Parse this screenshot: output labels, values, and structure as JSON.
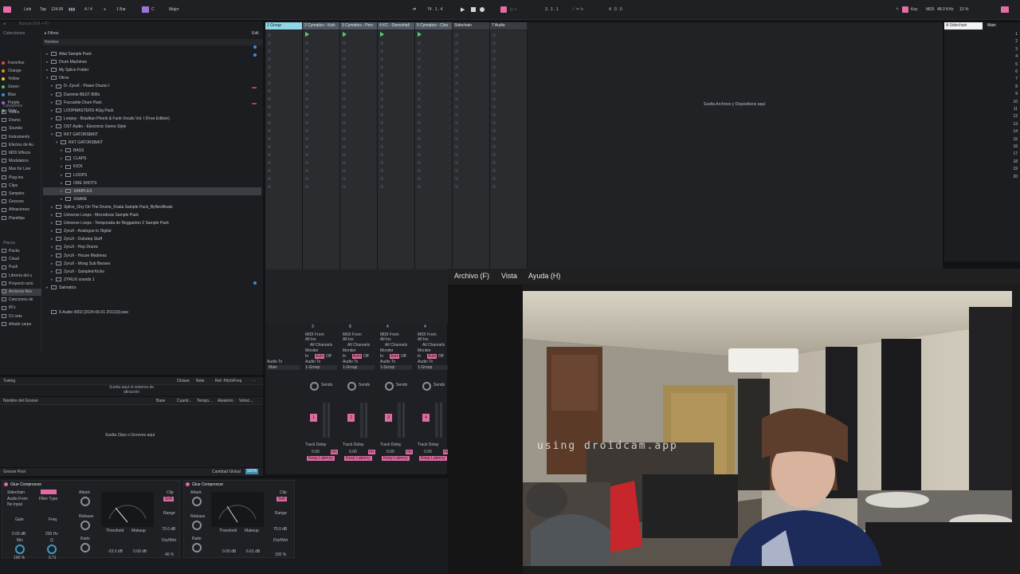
{
  "topbar": {
    "link": "Link",
    "tap": "Tap",
    "tempo": "124.00",
    "signature": "4 / 4",
    "quantize": "1 Bar",
    "key": "C",
    "scale": "Major",
    "position": "74 . 1 . 4",
    "loop_start": "3 . 1 . 1",
    "loop_length": "4 . 0 . 0",
    "key_label": "Key",
    "midi_label": "MIDI",
    "sample_rate": "48.0 KHz",
    "cpu": "13 %"
  },
  "browser": {
    "search_placeholder": "Buscar (Ctrl + F)",
    "filters_label": "Filtros",
    "edit_label": "Edit",
    "name_header": "Nombre",
    "collections_label": "Colecciones",
    "collections": [
      {
        "label": "Favoritos",
        "color": "#e04a4a"
      },
      {
        "label": "Orange",
        "color": "#e8872f"
      },
      {
        "label": "Yellow",
        "color": "#e1cd33"
      },
      {
        "label": "Green",
        "color": "#55c15a"
      },
      {
        "label": "Blue",
        "color": "#3e8de0"
      },
      {
        "label": "Purple",
        "color": "#a25ad6"
      },
      {
        "label": "Gray",
        "color": "#8f9297"
      }
    ],
    "categories_label": "Categories",
    "categories": [
      "Todos",
      "Drums",
      "Sounds",
      "Instruments",
      "Efectos de Au",
      "MIDI Effects",
      "Modulators",
      "Max for Live",
      "Plug-ins",
      "Clips",
      "Samples",
      "Grooves",
      "Afinaciones",
      "Plantillas"
    ],
    "places_label": "Places",
    "places": [
      "Packs",
      "Cloud",
      "Push",
      "Librería del u",
      "Proyecto actu",
      "Archivos Rec",
      "Canciones de",
      "IR's",
      "DJ sets",
      "Añadir carpe"
    ],
    "files": [
      {
        "label": "Atlat Sample Pack",
        "indent": 0,
        "arrow": "▸"
      },
      {
        "label": "Drum Machines",
        "indent": 0,
        "arrow": "▸"
      },
      {
        "label": "My Splice Folder",
        "indent": 0,
        "arrow": "▸"
      },
      {
        "label": "Otros",
        "indent": 0,
        "arrow": "▾"
      },
      {
        "label": "D- ZyruX - Power Drums I",
        "indent": 1,
        "arrow": "▸"
      },
      {
        "label": "Dummie BEST 808s",
        "indent": 1,
        "arrow": "▸"
      },
      {
        "label": "Foccanite  Drum  Pack",
        "indent": 1,
        "arrow": "▸"
      },
      {
        "label": "LOOPMASTERS 4Gig Pack",
        "indent": 1,
        "arrow": "▸"
      },
      {
        "label": "Loopsy - Brazilian Phonk & Funk Vocals Vol. I (Free Edition)",
        "indent": 1,
        "arrow": "▸"
      },
      {
        "label": "OST Audio - Electronic Genre Style",
        "indent": 1,
        "arrow": "▸"
      },
      {
        "label": "RKT GATORSBAIT",
        "indent": 1,
        "arrow": "▾"
      },
      {
        "label": "RKT GATORSBAIT",
        "indent": 2,
        "arrow": "▾"
      },
      {
        "label": "BASS",
        "indent": 3,
        "arrow": "▸"
      },
      {
        "label": "CLAPS",
        "indent": 3,
        "arrow": "▸"
      },
      {
        "label": "KICK",
        "indent": 3,
        "arrow": "▸"
      },
      {
        "label": "LOOPS",
        "indent": 3,
        "arrow": "▸"
      },
      {
        "label": "ONE SHOTS",
        "indent": 3,
        "arrow": "▸"
      },
      {
        "label": "SAMPLES",
        "indent": 3,
        "arrow": "▸",
        "selected": true
      },
      {
        "label": "SNARE",
        "indent": 3,
        "arrow": "▸"
      },
      {
        "label": "Splice_Ony On The Drums_Koala Sample Pack_ByNeoBeats",
        "indent": 1,
        "arrow": "▸"
      },
      {
        "label": "Universe Loops - Microdosis Sample Pack",
        "indent": 1,
        "arrow": "▸"
      },
      {
        "label": "Universe Loops - Temporada de Reggaeton 2 Sample Pack",
        "indent": 1,
        "arrow": "▸"
      },
      {
        "label": "ZyruX - Analogue to Digital",
        "indent": 1,
        "arrow": "▸"
      },
      {
        "label": "ZyruX - Dubstep Stuff",
        "indent": 1,
        "arrow": "▸"
      },
      {
        "label": "ZyruX - Hop Drums",
        "indent": 1,
        "arrow": "▸"
      },
      {
        "label": "ZyruX - House Madness",
        "indent": 1,
        "arrow": "▸"
      },
      {
        "label": "ZyruX - Moog Sub Basses",
        "indent": 1,
        "arrow": "▸"
      },
      {
        "label": "ZyruX - Sampled Kicks",
        "indent": 1,
        "arrow": "▸"
      },
      {
        "label": "ZYRUX sounds 1",
        "indent": 1,
        "arrow": "▸"
      },
      {
        "label": "Saimatics",
        "indent": 0,
        "arrow": "▸"
      },
      {
        "label": "6-Audio 0002 [2024-06-01 201110].wav",
        "indent": 0,
        "arrow": "",
        "file": true
      }
    ]
  },
  "tuning": {
    "title": "Tuning",
    "drop_text": "Suelta aquí el sistema de afinación",
    "col_octave": "Octave",
    "col_note": "Note",
    "col_ref": "Ref. Pitch/Freq"
  },
  "groove": {
    "col_name": "Nombre del Groove",
    "col_base": "Base",
    "col_quant": "Cuanti...",
    "col_timing": "Tempo...",
    "col_random": "Aleatorio",
    "col_velocity": "Veloci...",
    "drop_text": "Suelta Clips o Grooves aquí",
    "footer": "Groove Pool",
    "global_label": "Cantidad Global",
    "global_value": "100%"
  },
  "session": {
    "tracks": [
      {
        "name": "1 Group",
        "color": "#8fd6e8"
      },
      {
        "name": "2 Cymatics - Kick",
        "color": "#4f5a63"
      },
      {
        "name": "3 Cymatics - Perc",
        "color": "#4f5a63"
      },
      {
        "name": "4 KC - Dancehall",
        "color": "#4f5a63"
      },
      {
        "name": "5 Cymatics - Clos",
        "color": "#4f5a63"
      },
      {
        "name": "Sidechain",
        "color": "#3a3d42"
      },
      {
        "name": "7 Audio",
        "color": "#3a3d42"
      }
    ],
    "drop_text": "Suelta Archivos y Dispositivos aquí",
    "return_track": "A Sidechain",
    "master_track": "Main",
    "scenes": [
      "1",
      "2",
      "3",
      "4",
      "5",
      "6",
      "7",
      "8",
      "9",
      "10",
      "11",
      "12",
      "13",
      "14",
      "15",
      "16",
      "17",
      "18",
      "19",
      "20"
    ]
  },
  "mixer": {
    "midi_from": "MIDI From",
    "all_ins": "All Ins",
    "all_channels": "All Channels",
    "monitor": "Monitor",
    "in": "In",
    "auto": "Auto",
    "off": "Off",
    "audio_to": "Audio To",
    "group_dest": "1-Group",
    "main_dest": "Main",
    "sends": "Sends",
    "track_delay": "Track Delay",
    "delay_value": "0.00",
    "ms": "ms",
    "keep_latency": "Keep Latency",
    "strip_numbers": [
      "1",
      "2",
      "3",
      "4",
      "5"
    ],
    "counts": [
      "3",
      "8",
      "4",
      "4",
      "1",
      "12",
      "2"
    ]
  },
  "devices": [
    {
      "name": "Glue Compressor",
      "sidechain": "Sidechain",
      "audio_from": "Audio From",
      "no_input": "No Input",
      "filter_type": "Filter Type",
      "gain_label": "Gain",
      "gain_value": "0.00 dB",
      "mix_label": "Mix",
      "mix_value": "100 %",
      "freq_label": "Freq",
      "freq_value": "200 Hz",
      "q_label": "Q",
      "q_value": "0.71",
      "attack": "Attack",
      "release": "Release",
      "ratio": "Ratio",
      "threshold_label": "Threshold",
      "threshold_value": "-33.3 dB",
      "makeup_label": "Makeup",
      "makeup_value": "0.00 dB",
      "clip": "Clip",
      "soft": "Soft",
      "range_label": "Range",
      "range_value": "70.0 dB",
      "drywet_label": "Dry/Wet",
      "drywet_value": "46 %"
    },
    {
      "name": "Glue Compressor",
      "attack": "Attack",
      "release": "Release",
      "ratio": "Ratio",
      "threshold_label": "Threshold",
      "threshold_value": "0.00 dB",
      "makeup_label": "Makeup",
      "makeup_value": "6.61 dB",
      "clip": "Clip",
      "soft": "Soft",
      "range_label": "Range",
      "range_value": "70.0 dB",
      "drywet_label": "Dry/Wet",
      "drywet_value": "100 %"
    }
  ],
  "overlay": {
    "menu": [
      "Archivo (F)",
      "Vista",
      "Ayuda (H)"
    ],
    "watermark": "using droidcam.app"
  }
}
